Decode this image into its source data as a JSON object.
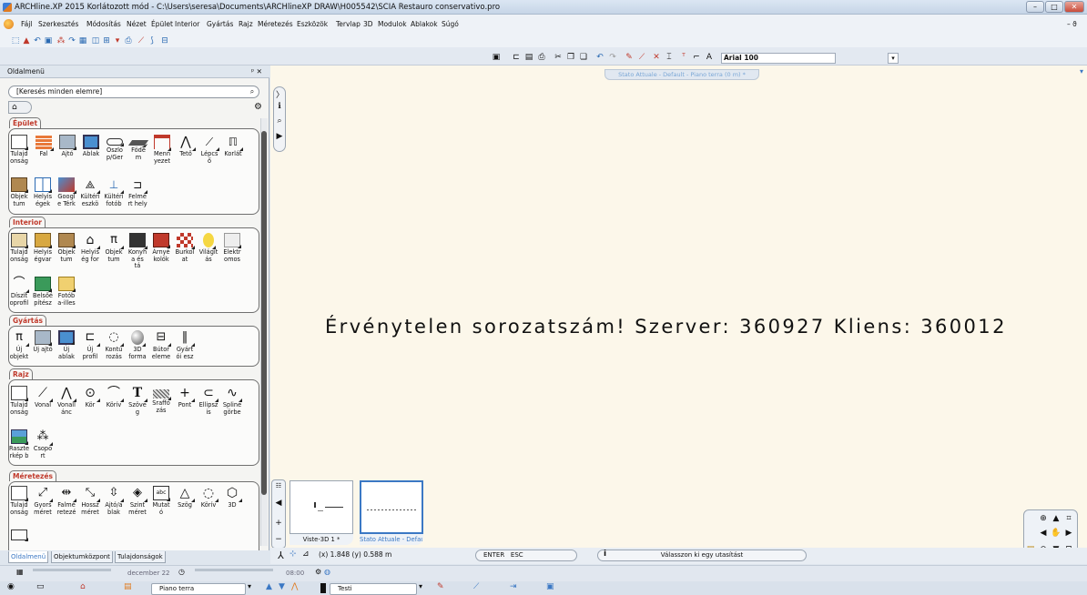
{
  "window": {
    "title": "ARCHline.XP 2015 Korlátozott mód - C:\\Users\\seresa\\Documents\\ARCHlineXP DRAW\\H005542\\SCIA Restauro conservativo.pro",
    "controls": [
      "–",
      "□",
      "✕"
    ]
  },
  "menubar": {
    "items": [
      "Fájl",
      "Szerkesztés",
      "Módosítás",
      "Nézet",
      "Épület",
      "Interior",
      "Gyártás",
      "Rajz",
      "Méretezés",
      "Eszközök",
      "Tervlap",
      "3D",
      "Modulok",
      "Ablakok",
      "Súgó"
    ],
    "right_glyph": "– ϑ"
  },
  "toolbar": {
    "font_name": "Arial 100"
  },
  "sidebar": {
    "title": "Oldalmenü",
    "pin_glyph": "ᵖ ✕",
    "search_placeholder": "[Keresés minden elemre]",
    "sections": [
      {
        "name": "Épület",
        "tools": [
          {
            "label": "Tulajd onság",
            "icon": "properties-icon"
          },
          {
            "label": "Fal",
            "icon": "wall-icon"
          },
          {
            "label": "Ajtó",
            "icon": "door-icon"
          },
          {
            "label": "Ablak",
            "icon": "window-icon"
          },
          {
            "label": "Oszlo p/Ger",
            "icon": "column-icon"
          },
          {
            "label": "Födé m",
            "icon": "slab-icon"
          },
          {
            "label": "Menn yezet",
            "icon": "ceiling-icon"
          },
          {
            "label": "Tető",
            "icon": "roof-icon"
          },
          {
            "label": "Lépcs ő",
            "icon": "stair-icon"
          },
          {
            "label": "Korlát",
            "icon": "railing-icon"
          },
          {
            "label": "Objek tum",
            "icon": "object-icon"
          },
          {
            "label": "Helyis égek",
            "icon": "room-icon"
          },
          {
            "label": "Googl e Térk",
            "icon": "google-map-icon"
          },
          {
            "label": "Kültéri eszkö",
            "icon": "outdoor-tool-icon"
          },
          {
            "label": "Kültéri fotób",
            "icon": "outdoor-photo-icon"
          },
          {
            "label": "Felmé rt hely",
            "icon": "survey-icon"
          }
        ]
      },
      {
        "name": "Interior",
        "tools": [
          {
            "label": "Tulajd onság",
            "icon": "properties-icon"
          },
          {
            "label": "Helyis égvar",
            "icon": "room-wall-icon"
          },
          {
            "label": "Objek tum",
            "icon": "object-icon"
          },
          {
            "label": "Helyis ég for",
            "icon": "room-shape-icon"
          },
          {
            "label": "Objek tum",
            "icon": "object2-icon"
          },
          {
            "label": "Konyh a és tá",
            "icon": "kitchen-icon"
          },
          {
            "label": "Árnyé kolók",
            "icon": "shade-icon"
          },
          {
            "label": "Burkol at",
            "icon": "tile-icon"
          },
          {
            "label": "Világít ás",
            "icon": "lighting-icon"
          },
          {
            "label": "Elektr omos",
            "icon": "electric-icon"
          },
          {
            "label": "Díszít oprofil",
            "icon": "molding-icon"
          },
          {
            "label": "Belsőé pítész",
            "icon": "interior-design-icon"
          },
          {
            "label": "Fotób a-illes",
            "icon": "photo-icon"
          }
        ]
      },
      {
        "name": "Gyártás",
        "tools": [
          {
            "label": "Új objekt",
            "icon": "new-object-icon"
          },
          {
            "label": "Új ajtó",
            "icon": "new-door-icon"
          },
          {
            "label": "Új ablak",
            "icon": "new-window-icon"
          },
          {
            "label": "Új profil",
            "icon": "new-profile-icon"
          },
          {
            "label": "Kontú rozás",
            "icon": "contour-icon"
          },
          {
            "label": "3D forma",
            "icon": "3d-shape-icon"
          },
          {
            "label": "Bútor eleme",
            "icon": "furniture-icon"
          },
          {
            "label": "Gyárt ói esz",
            "icon": "manufacture-tool-icon"
          }
        ]
      },
      {
        "name": "Rajz",
        "tools": [
          {
            "label": "Tulajd onság",
            "icon": "properties-icon"
          },
          {
            "label": "Vonal",
            "icon": "line-icon"
          },
          {
            "label": "Vonall ánc",
            "icon": "polyline-icon"
          },
          {
            "label": "Kör",
            "icon": "circle-icon"
          },
          {
            "label": "Körív",
            "icon": "arc-icon"
          },
          {
            "label": "Szöve g",
            "icon": "text-icon"
          },
          {
            "label": "Sraffo zás",
            "icon": "hatch-icon"
          },
          {
            "label": "Pont",
            "icon": "point-icon"
          },
          {
            "label": "Ellipsz is",
            "icon": "ellipse-icon"
          },
          {
            "label": "Spline görbe",
            "icon": "spline-icon"
          },
          {
            "label": "Raszte rkép b",
            "icon": "raster-icon"
          },
          {
            "label": "Csopo rt",
            "icon": "group-icon"
          }
        ]
      },
      {
        "name": "Méretezés",
        "tools": [
          {
            "label": "Tulajd onság",
            "icon": "properties-icon"
          },
          {
            "label": "Gyors méret",
            "icon": "quick-dimension-icon"
          },
          {
            "label": "Falmé retezé",
            "icon": "wall-dimension-icon"
          },
          {
            "label": "Hossz méret",
            "icon": "length-dimension-icon"
          },
          {
            "label": "Ajtó/a blak",
            "icon": "door-window-dimension-icon"
          },
          {
            "label": "Szint méret",
            "icon": "level-dimension-icon"
          },
          {
            "label": "Mutat ó",
            "icon": "pointer-icon"
          },
          {
            "label": "Szög",
            "icon": "angle-icon"
          },
          {
            "label": "Körív",
            "icon": "arc-dimension-icon"
          },
          {
            "label": "3D",
            "icon": "3d-dimension-icon"
          },
          {
            "label": "",
            "icon": "annotation-icon"
          }
        ]
      }
    ],
    "tabs": [
      "Oldalmenü",
      "Objektumközpont",
      "Tulajdonságok"
    ]
  },
  "canvas": {
    "view_tab": "Stato Attuale - Default - Piano terra (0 m) *",
    "warning": "Érvénytelen sorozatszám! Szerver: 360927 Kliens: 360012",
    "thumbnails": [
      {
        "label": "Viste-3D 1 *",
        "active": false
      },
      {
        "label": "Stato Attuale - Defaul",
        "active": true
      }
    ]
  },
  "statusbar": {
    "coordinates": "(x) 1.848  (y) 0.588 m",
    "enter": "ENTER",
    "esc": "ESC",
    "prompt": "Válasszon ki egy utasítást",
    "date": "december 22",
    "time": "08:00"
  },
  "bottombar": {
    "floor": "Piano terra",
    "layer": "Testi"
  },
  "colors": {
    "canvas_bg": "#fcf7ea",
    "section_header": "#c0392b",
    "active_tab": "#3b78c4"
  }
}
